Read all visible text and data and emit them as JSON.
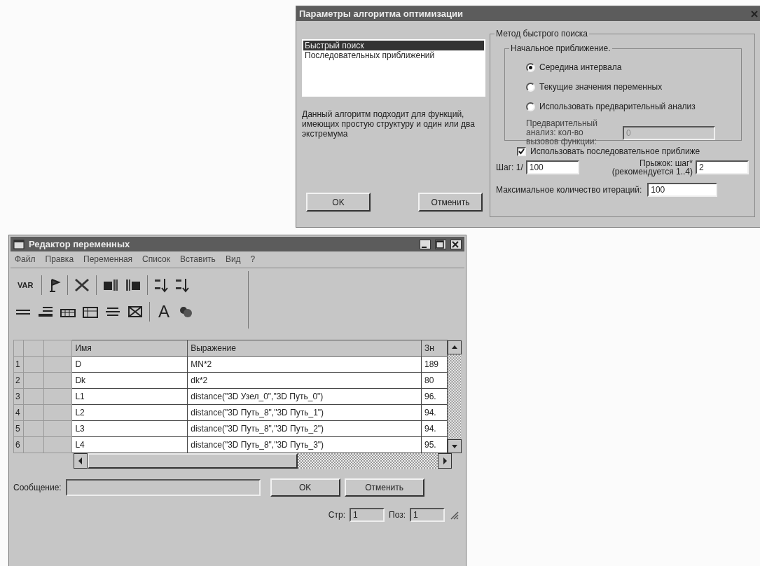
{
  "dialog": {
    "title": "Параметры алгоритма оптимизации",
    "algorithms": [
      {
        "label": "Быстрый поиск",
        "selected": true
      },
      {
        "label": "Последовательных приближений",
        "selected": false
      }
    ],
    "description": "Данный алгоритм подходит для функций, имеющих простую  структуру и один или два экстремума",
    "buttons": [
      "OK",
      "Отменить"
    ],
    "method_group": {
      "title": "Метод быстрого поиска",
      "initial_group": {
        "title": "Начальное приближение.",
        "options": [
          {
            "label": "Середина интервала",
            "selected": true
          },
          {
            "label": "Текущие значения переменных",
            "selected": false
          },
          {
            "label": "Использовать предварительный анализ",
            "selected": false
          }
        ],
        "pre_analysis": {
          "label": "Предварительный анализ: кол-во вызовов функции:",
          "value": "0",
          "disabled": true
        }
      },
      "sequential": {
        "label": "Использовать последовательное приближе",
        "checked": true
      },
      "step": {
        "label": "Шаг: 1/",
        "value": "100"
      },
      "jump": {
        "label": "Прыжок: шаг*",
        "hint": "(рекомендуется 1..4)",
        "value": "2"
      },
      "max_iterations": {
        "label": "Максимальное количество итераций:",
        "value": "100"
      }
    }
  },
  "editor": {
    "title": "Редактор переменных",
    "menu": [
      "Файл",
      "Правка",
      "Переменная",
      "Список",
      "Вставить",
      "Вид",
      "?"
    ],
    "toolbar": {
      "var_button": "VAR",
      "font_button": "A"
    },
    "columns": [
      "Имя",
      "Выражение",
      "Зн"
    ],
    "rows": [
      {
        "number": "1",
        "name": "D",
        "expression": "MN*2",
        "value": "189"
      },
      {
        "number": "2",
        "name": "Dk",
        "expression": "dk*2",
        "value": "80"
      },
      {
        "number": "3",
        "name": "L1",
        "expression": "distance(\"3D Узел_0\",\"3D Путь_0\")",
        "value": "96."
      },
      {
        "number": "4",
        "name": "L2",
        "expression": "distance(\"3D Путь_8\",\"3D Путь_1\")",
        "value": "94."
      },
      {
        "number": "5",
        "name": "L3",
        "expression": "distance(\"3D Путь_8\",\"3D Путь_2\")",
        "value": "94."
      },
      {
        "number": "6",
        "name": "L4",
        "expression": "distance(\"3D Путь_8\",\"3D Путь_3\")",
        "value": "95."
      }
    ],
    "message_label": "Сообщение:",
    "buttons": [
      "OK",
      "Отменить"
    ],
    "status": {
      "line_label": "Стр:",
      "line_value": "1",
      "pos_label": "Поз:",
      "pos_value": "1"
    }
  }
}
